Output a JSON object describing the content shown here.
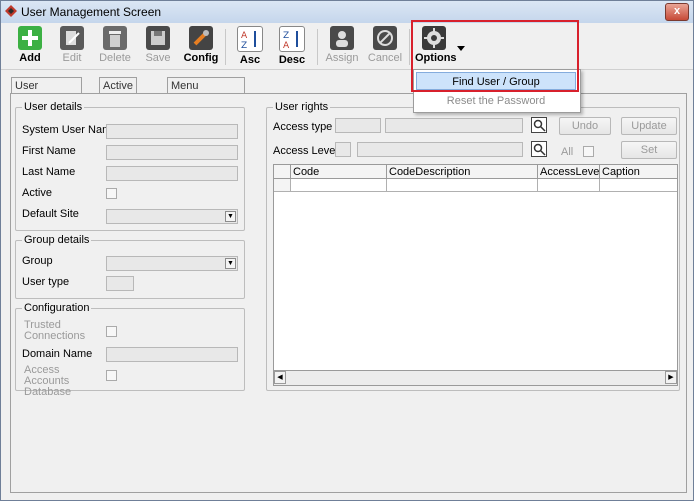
{
  "window": {
    "title": "User Management Screen",
    "close_label": "x"
  },
  "toolbar": {
    "buttons": [
      {
        "label": "Add",
        "icon": "add-icon",
        "color": "#3cb043"
      },
      {
        "label": "Edit",
        "icon": "edit-icon"
      },
      {
        "label": "Delete",
        "icon": "delete-icon"
      },
      {
        "label": "Save",
        "icon": "save-icon"
      },
      {
        "label": "Config",
        "icon": "config-icon"
      },
      {
        "label": "Asc",
        "icon": "sort-asc-icon"
      },
      {
        "label": "Desc",
        "icon": "sort-desc-icon"
      },
      {
        "label": "Assign",
        "icon": "assign-icon"
      },
      {
        "label": "Cancel",
        "icon": "cancel-icon"
      },
      {
        "label": "Options",
        "icon": "gear-icon"
      }
    ]
  },
  "options_menu": {
    "items": [
      "Find User / Group",
      "Reset the Password"
    ]
  },
  "tabs": [
    "User Maintenance",
    "Active Users",
    "Menu Customisation"
  ],
  "user_details": {
    "legend": "User details",
    "labels": [
      "System User Name",
      "First Name",
      "Last Name",
      "Active",
      "Default Site"
    ]
  },
  "group_details": {
    "legend": "Group details",
    "labels": [
      "Group",
      "User type"
    ]
  },
  "configuration": {
    "legend": "Configuration",
    "labels": [
      "Trusted Connections",
      "Domain Name",
      "Access Accounts Database"
    ]
  },
  "user_rights": {
    "legend": "User rights",
    "access_type_label": "Access type",
    "access_level_label": "Access Level",
    "all_label": "All",
    "buttons": {
      "undo": "Undo",
      "update": "Update",
      "set": "Set"
    },
    "columns": [
      "Code",
      "CodeDescription",
      "AccessLevel",
      "Caption"
    ]
  },
  "colors": {
    "highlight": "#d8202c",
    "menu_selected": "#cde3fb"
  }
}
